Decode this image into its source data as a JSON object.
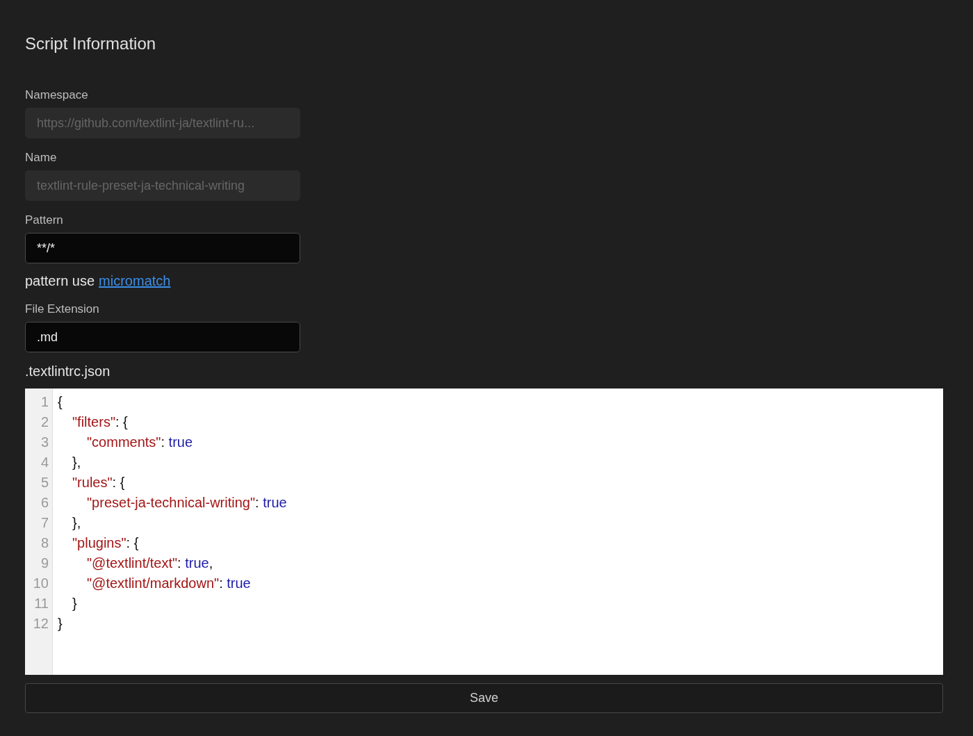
{
  "title": "Script Information",
  "fields": [
    {
      "label": "Namespace",
      "value": "https://github.com/textlint-ja/textlint-ru...",
      "disabled": true
    },
    {
      "label": "Name",
      "value": "textlint-rule-preset-ja-technical-writing",
      "disabled": true
    },
    {
      "label": "Pattern",
      "value": "**/*",
      "disabled": false,
      "hint": {
        "text": "pattern use",
        "link": "micromatch"
      }
    },
    {
      "label": "File Extension",
      "value": ".md",
      "disabled": false
    }
  ],
  "editor": {
    "label": ".textlintrc.json",
    "lines": [
      {
        "number": "1",
        "tokens": [
          {
            "kind": "punct",
            "text": "{"
          }
        ],
        "children": [
          {
            "number": "2",
            "tokens": [
              {
                "kind": "key",
                "text": "\"filters\""
              },
              {
                "kind": "punct",
                "text": ": {"
              }
            ],
            "children": [
              {
                "number": "3",
                "tokens": [
                  {
                    "kind": "key",
                    "text": "\"comments\""
                  },
                  {
                    "kind": "punct",
                    "text": ": "
                  },
                  {
                    "kind": "value",
                    "text": "true"
                  }
                ]
              }
            ]
          },
          {
            "number": "4",
            "tokens": [
              {
                "kind": "punct",
                "text": "},"
              }
            ]
          },
          {
            "number": "5",
            "tokens": [
              {
                "kind": "key",
                "text": "\"rules\""
              },
              {
                "kind": "punct",
                "text": ": {"
              }
            ],
            "children": [
              {
                "number": "6",
                "tokens": [
                  {
                    "kind": "key",
                    "text": "\"preset-ja-technical-writing\""
                  },
                  {
                    "kind": "punct",
                    "text": ": "
                  },
                  {
                    "kind": "value",
                    "text": "true"
                  }
                ]
              }
            ]
          },
          {
            "number": "7",
            "tokens": [
              {
                "kind": "punct",
                "text": "},"
              }
            ]
          },
          {
            "number": "8",
            "tokens": [
              {
                "kind": "key",
                "text": "\"plugins\""
              },
              {
                "kind": "punct",
                "text": ": {"
              }
            ],
            "children": [
              {
                "number": "9",
                "tokens": [
                  {
                    "kind": "key",
                    "text": "\"@textlint/text\""
                  },
                  {
                    "kind": "punct",
                    "text": ": "
                  },
                  {
                    "kind": "value",
                    "text": "true"
                  },
                  {
                    "kind": "punct",
                    "text": ","
                  }
                ]
              },
              {
                "number": "10",
                "tokens": [
                  {
                    "kind": "key",
                    "text": "\"@textlint/markdown\""
                  },
                  {
                    "kind": "punct",
                    "text": ": "
                  },
                  {
                    "kind": "value",
                    "text": "true"
                  }
                ]
              }
            ]
          },
          {
            "number": "11",
            "tokens": [
              {
                "kind": "punct",
                "text": "}"
              }
            ]
          }
        ]
      },
      {
        "number": "12",
        "tokens": [
          {
            "kind": "punct",
            "text": "}"
          }
        ]
      }
    ]
  },
  "save_button": "Save"
}
